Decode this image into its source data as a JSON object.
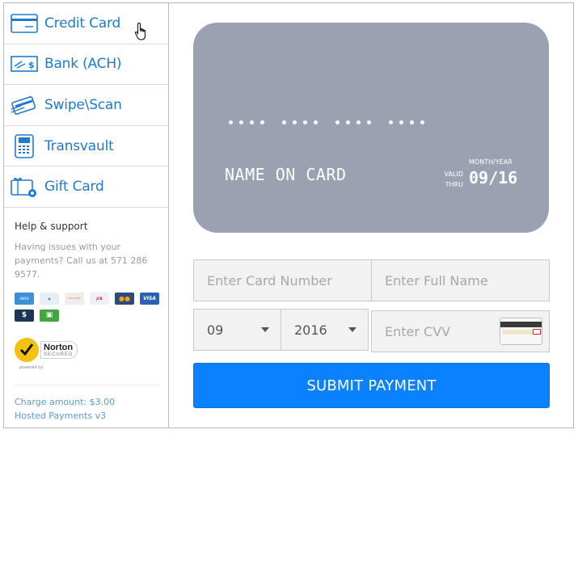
{
  "sidebar": {
    "items": [
      {
        "label": "Credit Card",
        "icon": "credit-card-icon"
      },
      {
        "label": "Bank (ACH)",
        "icon": "check-icon"
      },
      {
        "label": "Swipe\\Scan",
        "icon": "swipe-card-icon"
      },
      {
        "label": "Transvault",
        "icon": "card-terminal-icon"
      },
      {
        "label": "Gift Card",
        "icon": "gift-card-icon"
      }
    ],
    "active": "Credit Card"
  },
  "help": {
    "title": "Help & support",
    "text": "Having issues with your payments? Call us at 571 286 9577.",
    "card_logos": [
      {
        "name": "amex",
        "label": "AMEX",
        "color": "#3d8fd8"
      },
      {
        "name": "diners",
        "label": "◉",
        "color": "#e8eef5"
      },
      {
        "name": "discover",
        "label": "DISCOVER",
        "color": "#eeeeee"
      },
      {
        "name": "jcb",
        "label": "JCB",
        "color": "#eef0f5"
      },
      {
        "name": "mastercard",
        "label": "●●",
        "color": "#2c4a7a"
      },
      {
        "name": "visa",
        "label": "VISA",
        "color": "#2a62b8"
      },
      {
        "name": "cash",
        "label": "$",
        "color": "#1b3556"
      },
      {
        "name": "gift",
        "label": "▣",
        "color": "#41a63f"
      }
    ],
    "norton": {
      "name": "Norton",
      "secured": "SECURED",
      "powered_by": "powered by"
    }
  },
  "charge": {
    "amount_text": "Charge amount: $3.00",
    "version_text": "Hosted Payments v3"
  },
  "card_preview": {
    "name": "NAME ON CARD",
    "month_year_label": "MONTH/YEAR",
    "valid_label": "VALID",
    "thru_label": "THRU",
    "expiry": "09/16"
  },
  "form": {
    "card_number_placeholder": "Enter Card Number",
    "full_name_placeholder": "Enter Full Name",
    "month": "09",
    "year": "2016",
    "cvv_placeholder": "Enter CVV",
    "submit_label": "SUBMIT PAYMENT"
  },
  "colors": {
    "accent": "#0a82ff",
    "link": "#1f7bd0",
    "card_bg": "#9aa2b1"
  }
}
